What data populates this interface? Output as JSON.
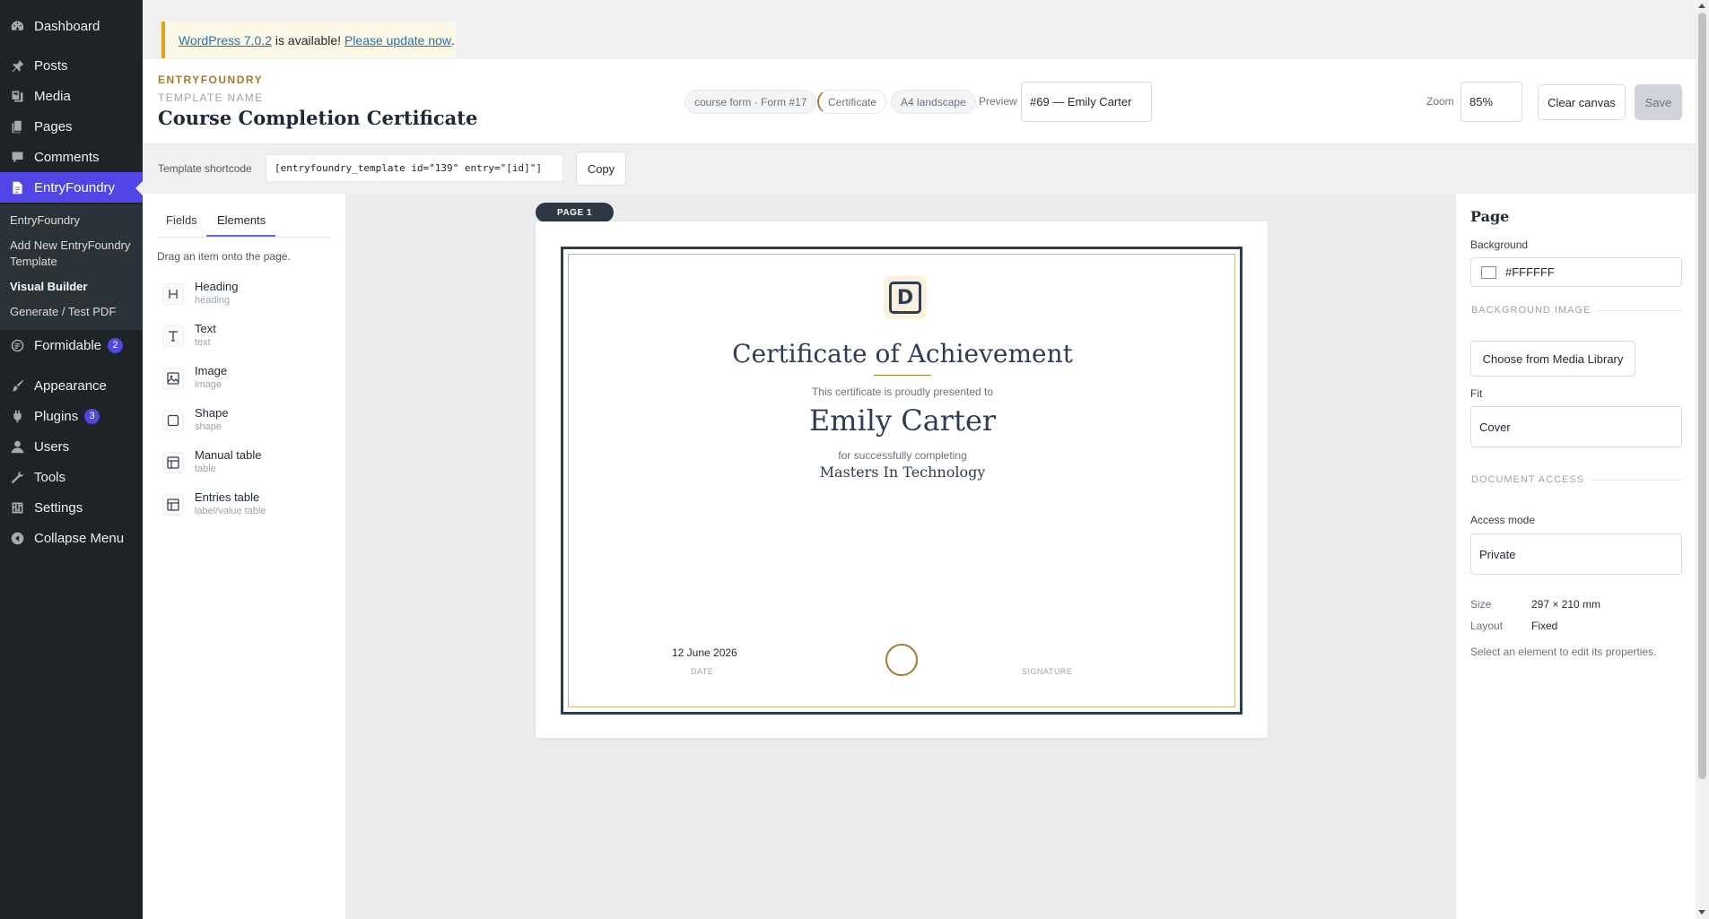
{
  "admin_menu": {
    "items": [
      {
        "label": "Dashboard",
        "icon": "dashboard-icon"
      },
      {
        "label": "Posts",
        "icon": "pin-icon"
      },
      {
        "label": "Media",
        "icon": "media-icon"
      },
      {
        "label": "Pages",
        "icon": "pages-icon"
      },
      {
        "label": "Comments",
        "icon": "comment-icon"
      },
      {
        "label": "EntryFoundry",
        "icon": "document-icon"
      },
      {
        "label": "Formidable",
        "icon": "formidable-icon",
        "badge": "2"
      },
      {
        "label": "Appearance",
        "icon": "brush-icon"
      },
      {
        "label": "Plugins",
        "icon": "plugin-icon",
        "badge": "3"
      },
      {
        "label": "Users",
        "icon": "user-icon"
      },
      {
        "label": "Tools",
        "icon": "wrench-icon"
      },
      {
        "label": "Settings",
        "icon": "settings-icon"
      },
      {
        "label": "Collapse Menu",
        "icon": "collapse-icon"
      }
    ],
    "submenu": [
      "EntryFoundry",
      "Add New EntryFoundry Template",
      "Visual Builder",
      "Generate / Test PDF"
    ]
  },
  "notice": {
    "link1": "WordPress 7.0.2",
    "middle": " is available! ",
    "link2": "Please update now",
    "end": "."
  },
  "header": {
    "brand": "ENTRYFOUNDRY",
    "template_label": "TEMPLATE NAME",
    "template_name": "Course Completion Certificate",
    "pills": [
      "course form · Form #17",
      "Certificate",
      "A4 landscape"
    ],
    "preview_label": "Preview",
    "preview_value": "#69 — Emily Carter",
    "zoom_label": "Zoom",
    "zoom_value": "85%",
    "clear_button": "Clear canvas",
    "save_button": "Save"
  },
  "shortcode": {
    "label": "Template shortcode",
    "code": "[entryfoundry_template id=\"139\" entry=\"[id]\"]",
    "copy_button": "Copy"
  },
  "left_panel": {
    "tabs": [
      "Fields",
      "Elements"
    ],
    "active_tab": "Elements",
    "hint": "Drag an item onto the page.",
    "elements": [
      {
        "title": "Heading",
        "sub": "heading",
        "icon": "heading-icon"
      },
      {
        "title": "Text",
        "sub": "text",
        "icon": "text-icon"
      },
      {
        "title": "Image",
        "sub": "image",
        "icon": "image-icon"
      },
      {
        "title": "Shape",
        "sub": "shape",
        "icon": "shape-icon"
      },
      {
        "title": "Manual table",
        "sub": "table",
        "icon": "table-icon"
      },
      {
        "title": "Entries table",
        "sub": "label/value table",
        "icon": "table-icon"
      }
    ]
  },
  "canvas": {
    "page_tag": "PAGE 1",
    "certificate": {
      "logo_letter": "D",
      "title": "Certificate of Achievement",
      "presented": "This certificate is proudly presented to",
      "name": "Emily Carter",
      "for_text": "for successfully completing",
      "course": "Masters In Technology",
      "date": "12 June 2026",
      "date_label": "DATE",
      "signature_label": "SIGNATURE"
    }
  },
  "right_panel": {
    "title": "Page",
    "background_label": "Background",
    "background_value": "#FFFFFF",
    "bg_image_section": "BACKGROUND IMAGE",
    "media_button": "Choose from Media Library",
    "fit_label": "Fit",
    "fit_value": "Cover",
    "access_section": "DOCUMENT ACCESS",
    "access_label": "Access mode",
    "access_value": "Private",
    "size_key": "Size",
    "size_value": "297 × 210 mm",
    "layout_key": "Layout",
    "layout_value": "Fixed",
    "note": "Select an element to edit its properties."
  }
}
